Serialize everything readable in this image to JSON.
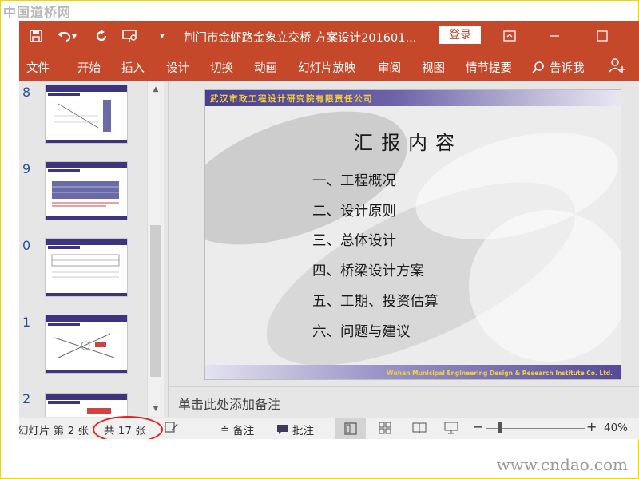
{
  "watermarks": {
    "top": "中国道桥网",
    "bottom": "www.cndao.com"
  },
  "titlebar": {
    "title": "荆门市金虾路金象立交桥 方案设计201601...",
    "login": "登录",
    "icons": [
      "save-icon",
      "undo-icon",
      "redo-icon",
      "present-from-start-icon",
      "customize-toolbar-icon",
      "ribbon-display-icon",
      "minimize-icon",
      "maximize-icon"
    ]
  },
  "ribbon": {
    "tabs": [
      "文件",
      "开始",
      "插入",
      "设计",
      "切换",
      "动画",
      "幻灯片放映",
      "审阅",
      "视图",
      "情节提要"
    ],
    "tell_me": "告诉我"
  },
  "thumbnails": [
    {
      "number": "8"
    },
    {
      "number": "9"
    },
    {
      "number": "0"
    },
    {
      "number": "1"
    },
    {
      "number": "2"
    }
  ],
  "slide": {
    "company": "武汉市政工程设计研究院有限责任公司",
    "title": "汇报内容",
    "items": [
      "一、工程概况",
      "二、设计原则",
      "三、总体设计",
      "四、桥梁设计方案",
      "五、工期、投资估算",
      "六、问题与建议"
    ],
    "footer": "Wuhan Municipal Engineering Design & Research Institute Co. Ltd."
  },
  "notes": {
    "placeholder": "单击此处添加备注"
  },
  "statusbar": {
    "slide_info": "幻灯片 第 2 张",
    "total": "共 17 张",
    "notes": "备注",
    "comments": "批注",
    "zoom": "40%"
  },
  "colors": {
    "accent": "#c6482a",
    "slide_band": "#4a3f8e",
    "highlight": "#e02020"
  }
}
